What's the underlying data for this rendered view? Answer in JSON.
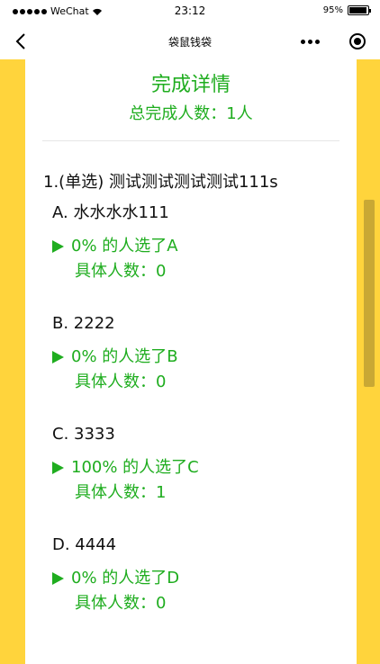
{
  "status_bar": {
    "carrier": "WeChat",
    "time": "23:12",
    "battery_percent": "95%",
    "battery_level": 0.95
  },
  "nav": {
    "title": "袋鼠钱袋"
  },
  "header": {
    "title": "完成详情",
    "subtitle": "总完成人数：1人"
  },
  "question": {
    "text": "1.(单选) 测试测试测试测试111s",
    "options": [
      {
        "label": "A. 水水水水111",
        "stat": "0% 的人选了A",
        "count": "具体人数：0"
      },
      {
        "label": "B. 2222",
        "stat": "0% 的人选了B",
        "count": "具体人数：0"
      },
      {
        "label": "C. 3333",
        "stat": "100% 的人选了C",
        "count": "具体人数：1"
      },
      {
        "label": "D. 4444",
        "stat": "0% 的人选了D",
        "count": "具体人数：0"
      }
    ]
  },
  "colors": {
    "accent_green": "#1fad1f",
    "frame_yellow": "#ffd43c"
  },
  "icons": [
    "signal-icon",
    "wifi-icon",
    "battery-icon",
    "back-icon",
    "more-icon",
    "close-icon",
    "play-icon"
  ]
}
